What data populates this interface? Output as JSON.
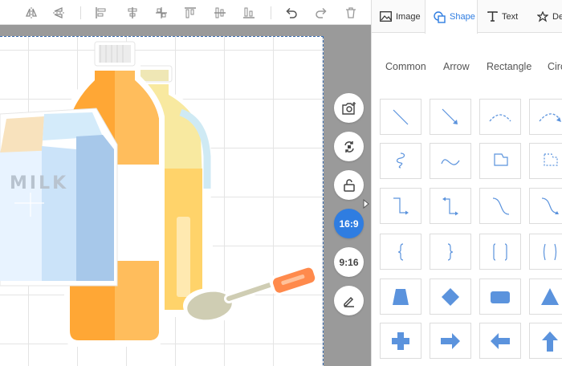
{
  "panel": {
    "tabs": [
      {
        "label": "Image",
        "icon": "image-icon"
      },
      {
        "label": "Shape",
        "icon": "shape-icon",
        "active": true
      },
      {
        "label": "Text",
        "icon": "text-icon"
      },
      {
        "label": "Deco",
        "icon": "decoration-icon"
      }
    ],
    "categories": [
      "Common",
      "Arrow",
      "Rectangle",
      "Circ"
    ]
  },
  "side_tools": [
    {
      "name": "screenshot",
      "icon": "camera-plus-icon"
    },
    {
      "name": "refresh",
      "icon": "refresh-icon"
    },
    {
      "name": "unlock",
      "icon": "unlock-icon"
    },
    {
      "name": "ratio-16-9",
      "label": "16:9",
      "active": true
    },
    {
      "name": "ratio-9-16",
      "label": "9:16"
    },
    {
      "name": "edit",
      "icon": "pencil-icon"
    }
  ],
  "artwork": {
    "carton_text": "MILK"
  },
  "colors": {
    "accent": "#2f7de1",
    "shape_blue": "#5b93dd"
  }
}
